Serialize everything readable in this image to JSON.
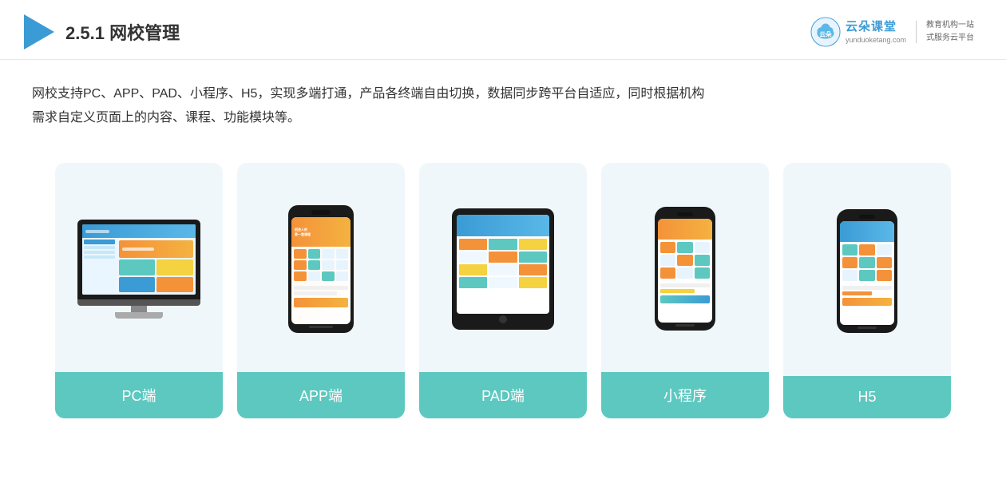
{
  "header": {
    "section_number": "2.5.1",
    "title": "网校管理",
    "brand": {
      "name": "云朵课堂",
      "url": "yunduoketang.com",
      "slogan_line1": "教育机构一站",
      "slogan_line2": "式服务云平台"
    }
  },
  "description": {
    "text_line1": "网校支持PC、APP、PAD、小程序、H5，实现多端打通，产品各终端自由切换，数据同步跨平台自适应，同时根据机构",
    "text_line2": "需求自定义页面上的内容、课程、功能模块等。"
  },
  "cards": [
    {
      "id": "pc",
      "label": "PC端"
    },
    {
      "id": "app",
      "label": "APP端"
    },
    {
      "id": "pad",
      "label": "PAD端"
    },
    {
      "id": "miniapp",
      "label": "小程序"
    },
    {
      "id": "h5",
      "label": "H5"
    }
  ]
}
